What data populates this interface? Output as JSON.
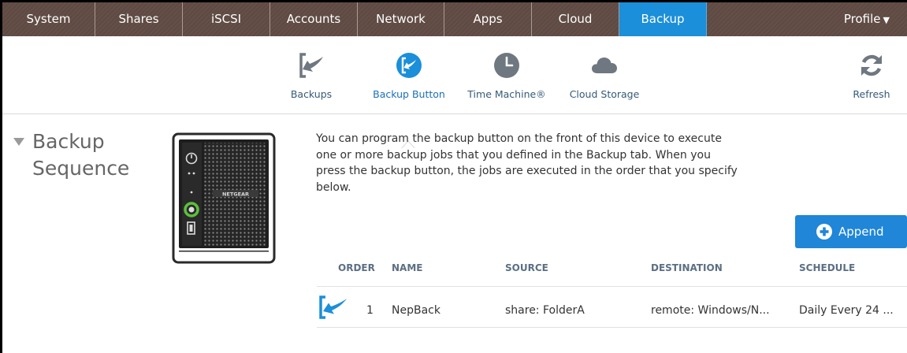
{
  "nav": {
    "tabs": [
      "System",
      "Shares",
      "iSCSI",
      "Accounts",
      "Network",
      "Apps",
      "Cloud",
      "Backup"
    ],
    "active_tab": "Backup",
    "profile_label": "Profile"
  },
  "subnav": {
    "items": [
      {
        "label": "Backups",
        "icon": "backup-arrow-icon"
      },
      {
        "label": "Backup Button",
        "icon": "backup-button-icon"
      },
      {
        "label": "Time Machine®",
        "icon": "clock-icon"
      },
      {
        "label": "Cloud Storage",
        "icon": "cloud-icon"
      }
    ],
    "active_item": "Backup Button",
    "refresh_label": "Refresh"
  },
  "section": {
    "title_line1": "Backup",
    "title_line2": "Sequence",
    "description": "You can program the backup button on the front of this device to execute one or more backup jobs that you defined in the Backup tab. When you press the backup button, the jobs are executed in the order that you specify below."
  },
  "device": {
    "brand": "NETGEAR"
  },
  "actions": {
    "append_label": "Append"
  },
  "table": {
    "headers": [
      "ORDER",
      "NAME",
      "SOURCE",
      "DESTINATION",
      "SCHEDULE"
    ],
    "rows": [
      {
        "order": "1",
        "name": "NepBack",
        "source": "share: FolderA",
        "destination": "remote: Windows/N...",
        "schedule": "Daily Every 24 ..."
      }
    ]
  },
  "colors": {
    "nav_bg": "#5e4a42",
    "accent": "#1b8fd9",
    "button_blue": "#1f86d8",
    "label_blue": "#355a7a",
    "icon_gray": "#6f7780",
    "led_green": "#5cc13a"
  }
}
